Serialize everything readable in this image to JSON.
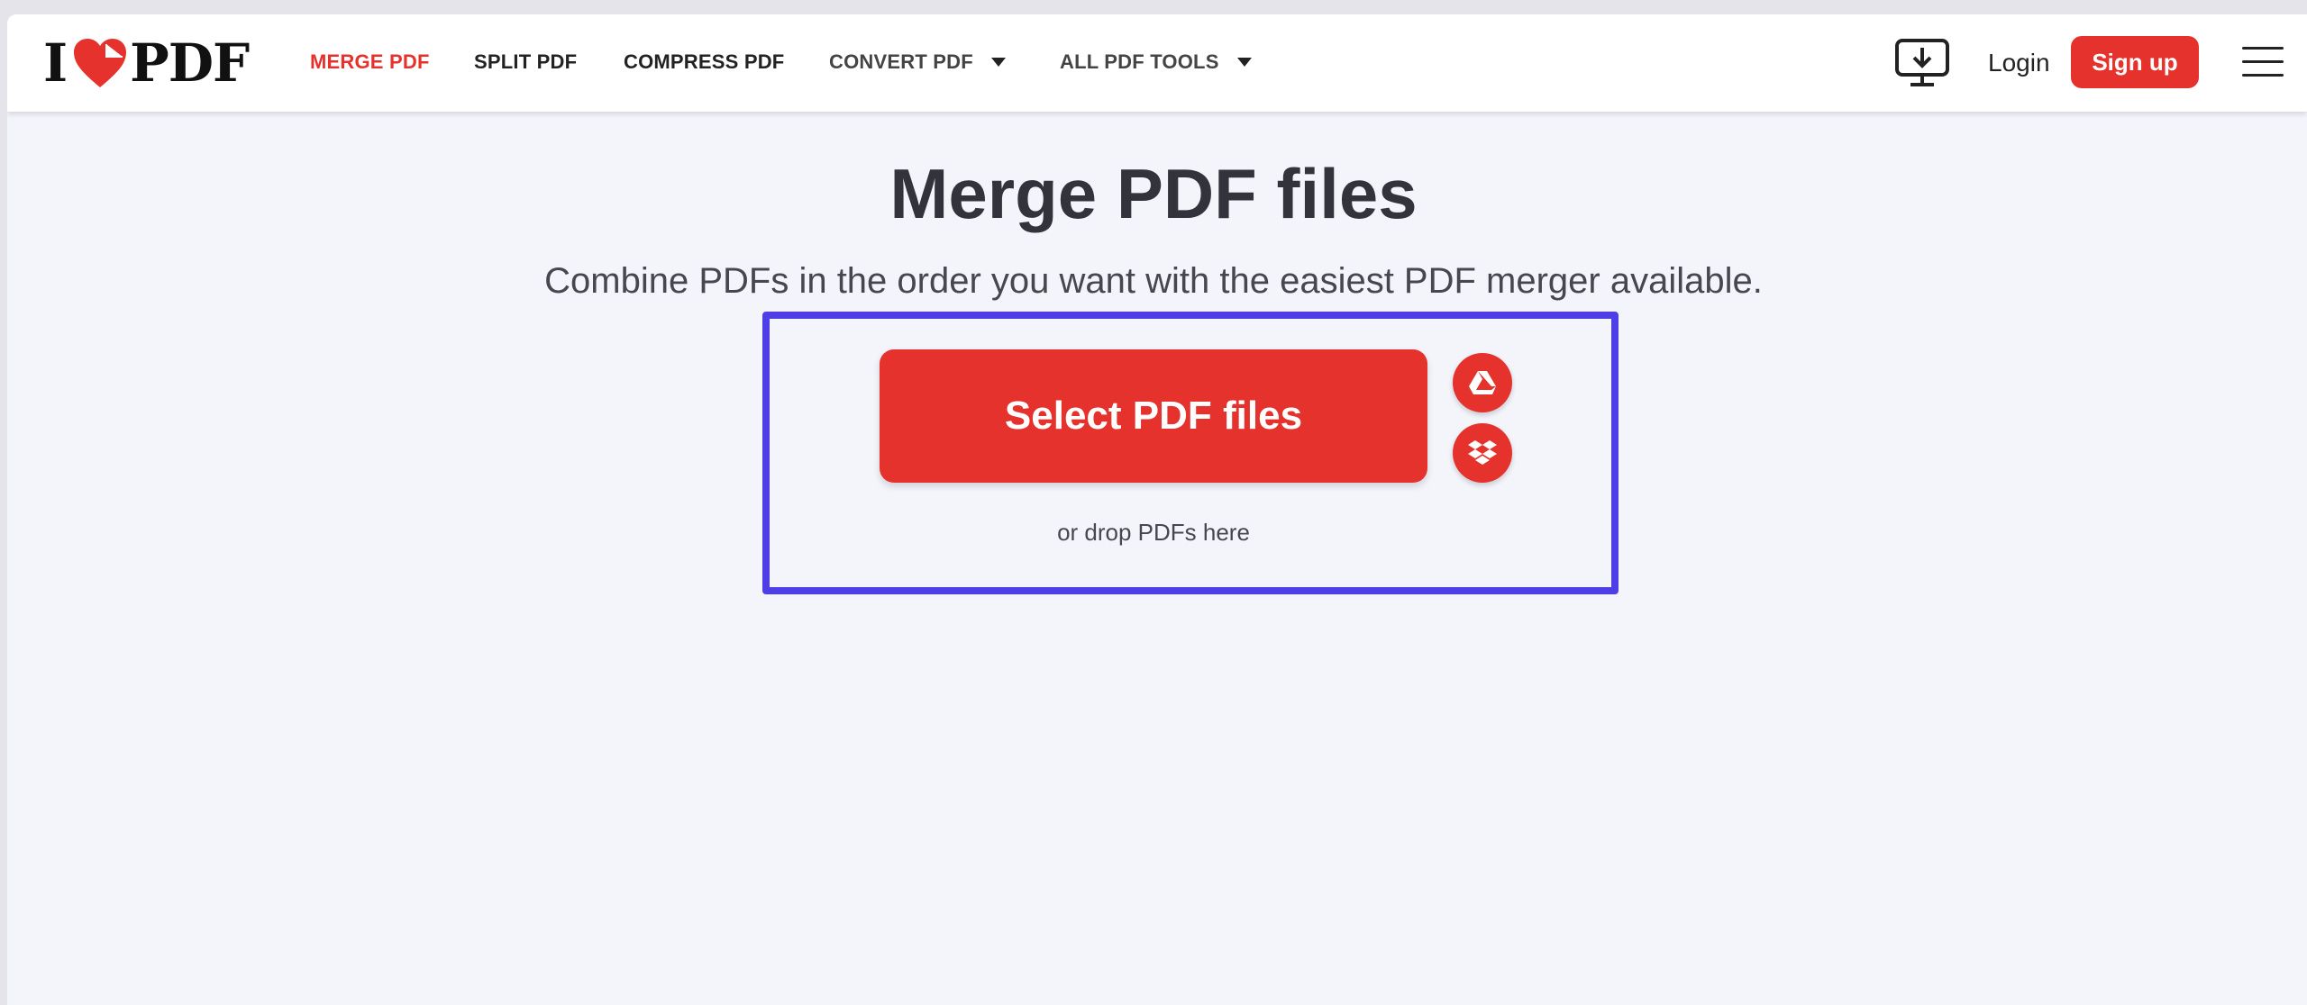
{
  "brand": {
    "logo_left": "I",
    "logo_right": "PDF",
    "accent_color": "#e5322d"
  },
  "nav": {
    "items": [
      {
        "label": "MERGE PDF",
        "active": true
      },
      {
        "label": "SPLIT PDF"
      },
      {
        "label": "COMPRESS PDF"
      },
      {
        "label": "CONVERT PDF",
        "dropdown": true
      },
      {
        "label": "ALL PDF TOOLS",
        "dropdown": true
      }
    ],
    "login_label": "Login",
    "signup_label": "Sign up",
    "icons": [
      "desktop-download-icon",
      "hamburger-menu-icon"
    ]
  },
  "main": {
    "title": "Merge PDF files",
    "subtitle": "Combine PDFs in the order you want with the easiest PDF merger available.",
    "select_button_label": "Select PDF files",
    "drop_hint": "or drop PDFs here",
    "cloud_sources": [
      "google-drive-icon",
      "dropbox-icon"
    ],
    "highlight_color": "#4e3ee6"
  }
}
